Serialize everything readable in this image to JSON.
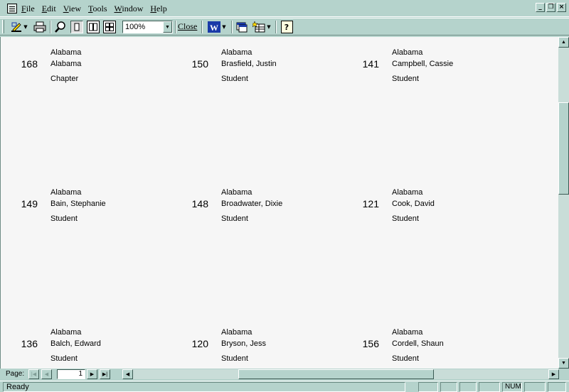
{
  "menu": {
    "items": [
      "File",
      "Edit",
      "View",
      "Tools",
      "Window",
      "Help"
    ]
  },
  "toolbar": {
    "zoom_value": "100%",
    "close_label": "Close"
  },
  "labels": [
    {
      "number": "168",
      "state": "Alabama",
      "name": "Alabama",
      "type": "Chapter"
    },
    {
      "number": "150",
      "state": "Alabama",
      "name": "Brasfield, Justin",
      "type": "Student"
    },
    {
      "number": "141",
      "state": "Alabama",
      "name": "Campbell, Cassie",
      "type": "Student"
    },
    {
      "number": "149",
      "state": "Alabama",
      "name": "Bain, Stephanie",
      "type": "Student"
    },
    {
      "number": "148",
      "state": "Alabama",
      "name": "Broadwater, Dixie",
      "type": "Student"
    },
    {
      "number": "121",
      "state": "Alabama",
      "name": "Cook, David",
      "type": "Student"
    },
    {
      "number": "136",
      "state": "Alabama",
      "name": "Balch, Edward",
      "type": "Student"
    },
    {
      "number": "120",
      "state": "Alabama",
      "name": "Bryson, Jess",
      "type": "Student"
    },
    {
      "number": "156",
      "state": "Alabama",
      "name": "Cordell, Shaun",
      "type": "Student"
    }
  ],
  "navigation": {
    "page_label": "Page:",
    "page_value": "1"
  },
  "status": {
    "text": "Ready",
    "num_indicator": "NUM"
  }
}
